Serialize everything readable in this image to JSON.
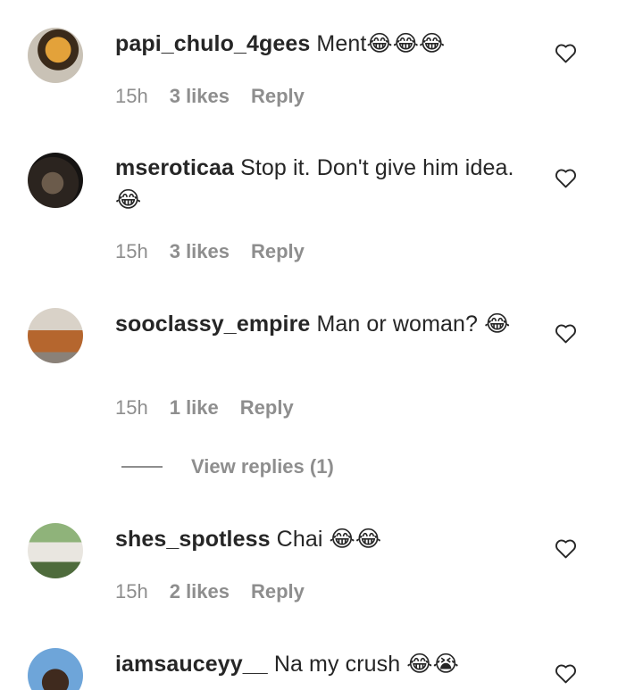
{
  "comments": [
    {
      "username": "papi_chulo_4gees",
      "text": "Ment",
      "emoji": "😂😂😂",
      "time": "15h",
      "likes": "3 likes",
      "reply": "Reply"
    },
    {
      "username": "mseroticaa",
      "text": "Stop it. Don't give him idea.",
      "emoji": "😂",
      "time": "15h",
      "likes": "3 likes",
      "reply": "Reply"
    },
    {
      "username": "sooclassy_empire",
      "text": "Man or woman?",
      "emoji": "😂",
      "time": "15h",
      "likes": "1 like",
      "reply": "Reply",
      "view_replies": "View replies (1)"
    },
    {
      "username": "shes_spotless",
      "text": "Chai",
      "emoji": "😂😂",
      "time": "15h",
      "likes": "2 likes",
      "reply": "Reply"
    },
    {
      "username": "iamsauceyy__",
      "text": "Na my crush",
      "emoji": "😂😭"
    }
  ],
  "icons": {
    "like": "heart-outline-icon"
  }
}
